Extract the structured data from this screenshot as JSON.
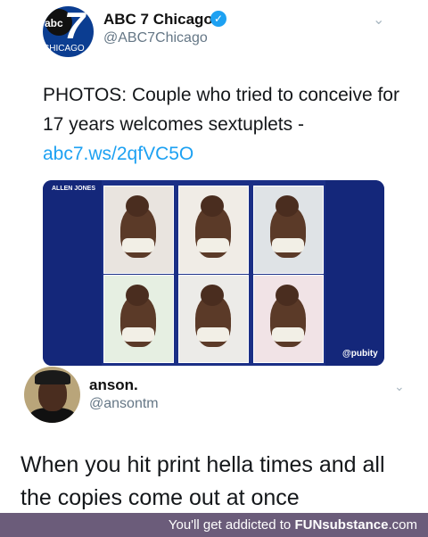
{
  "tweet": {
    "author_name": "ABC 7 Chicago",
    "author_handle": "@ABC7Chicago",
    "avatar_text": {
      "abc": "abc",
      "seven": "7",
      "city": "CHICAGO"
    },
    "text": "PHOTOS: Couple who tried to conceive for 17 years welcomes sextuplets - ",
    "link": "abc7.ws/2qfVC5O",
    "verified_glyph": "✓",
    "menu_glyph": "⌄"
  },
  "photo_card": {
    "caption": "ALLEN JONES",
    "watermark": "@pubity",
    "photo_count": 6
  },
  "reply": {
    "author_name": "anson.",
    "author_handle": "@ansontm",
    "text": "When you hit print hella times and all the copies come out at once",
    "menu_glyph": "⌄"
  },
  "footer": {
    "prefix": "You'll get addicted to ",
    "brand": "FUNsubstance",
    "suffix": ".com"
  },
  "colors": {
    "link": "#1da1f2",
    "verified": "#1da1f2",
    "card_bg": "#1b2f86",
    "footer_bg": "#6b5c7a"
  }
}
